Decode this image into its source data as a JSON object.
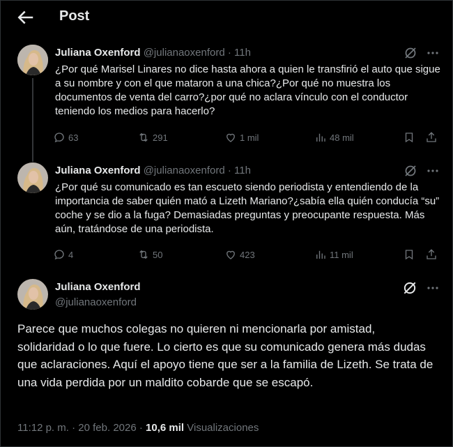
{
  "header": {
    "title": "Post"
  },
  "colors": {
    "background": "#000000",
    "text": "#e7e9ea",
    "muted": "#71767b",
    "divider": "#2f3336"
  },
  "tweets": [
    {
      "name": "Juliana Oxenford",
      "handle": "@julianaoxenford",
      "sep": "·",
      "time": "11h",
      "text": "¿Por qué Marisel Linares no dice hasta ahora a quien le transfirió el auto que sigue a su nombre y con el que mataron a una chica?¿Por qué no muestra los documentos de venta del carro?¿por qué no aclara vínculo con el conductor teniendo los medios para hacerlo?",
      "replies": "63",
      "reposts": "291",
      "likes": "1 mil",
      "views": "48 mil"
    },
    {
      "name": "Juliana Oxenford",
      "handle": "@julianaoxenford",
      "sep": "·",
      "time": "11h",
      "text": "¿Por qué su comunicado es tan escueto siendo periodista y entendiendo de la importancia de saber quién mató a Lizeth Mariano?¿sabía ella quién conducía “su” coche y se dio a la fuga? Demasiadas preguntas y preocupante respuesta. Más aún, tratándose de una periodista.",
      "replies": "4",
      "reposts": "50",
      "likes": "423",
      "views": "11 mil"
    }
  ],
  "main": {
    "name": "Juliana Oxenford",
    "handle": "@julianaoxenford",
    "text": "Parece que muchos colegas no quieren ni mencionarla por amistad, solidaridad o lo que fuere. Lo cierto es que su comunicado genera más dudas que aclaraciones. Aquí el apoyo tiene que ser a la familia de Lizeth. Se trata de una vida perdida por un maldito cobarde que se escapó.",
    "time": "11:12 p. m.",
    "sep": "·",
    "date": "20 feb. 2026",
    "views_sep": "·",
    "views_count": "10,6 mil",
    "views_label": "Visualizaciones"
  },
  "icons": {
    "back": "arrow-left-icon",
    "grok": "grok-icon",
    "more": "more-icon",
    "reply": "reply-icon",
    "repost": "repost-icon",
    "like": "heart-icon",
    "views": "analytics-icon",
    "bookmark": "bookmark-icon",
    "share": "share-icon"
  }
}
